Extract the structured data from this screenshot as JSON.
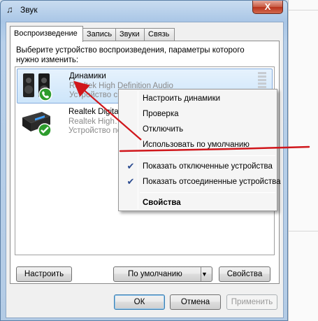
{
  "window": {
    "title": "Звук",
    "close_label": "X"
  },
  "tabs": [
    {
      "label": "Воспроизведение"
    },
    {
      "label": "Запись"
    },
    {
      "label": "Звуки"
    },
    {
      "label": "Связь"
    }
  ],
  "instructions": "Выберите устройство воспроизведения, параметры которого нужно изменить:",
  "devices": [
    {
      "name": "Динамики",
      "driver": "Realtek High Definition Audio",
      "status": "Устройство св…",
      "icon": "speakers-icon",
      "badge": "default-phone-badge"
    },
    {
      "name": "Realtek Digital",
      "driver": "Realtek High…",
      "status": "Устройство по…",
      "icon": "digital-receiver-icon",
      "badge": "check-badge"
    }
  ],
  "context_menu": {
    "items": [
      {
        "label": "Настроить динамики"
      },
      {
        "label": "Проверка"
      },
      {
        "label": "Отключить"
      },
      {
        "label": "Использовать по умолчанию"
      },
      {
        "label": "Показать отключенные устройства",
        "checked": true
      },
      {
        "label": "Показать отсоединенные устройства",
        "checked": true
      },
      {
        "label": "Свойства"
      }
    ]
  },
  "panel_buttons": {
    "configure": "Настроить",
    "set_default": "По умолчанию",
    "properties": "Свойства"
  },
  "dialog_buttons": {
    "ok": "ОК",
    "cancel": "Отмена",
    "apply": "Применить"
  },
  "colors": {
    "annotation_red": "#d0161b",
    "selection_border": "#84acdd",
    "check_mark": "#2a4a8f"
  }
}
